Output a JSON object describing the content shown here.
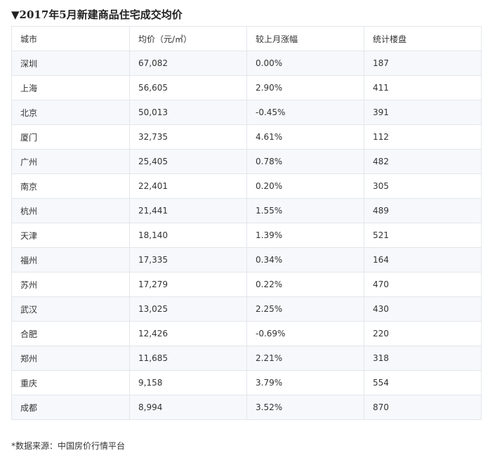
{
  "title": "▼2017年5月新建商品住宅成交均价",
  "table": {
    "headers": [
      "城市",
      "均价（元/㎡）",
      "较上月涨幅",
      "统计楼盘"
    ],
    "rows": [
      [
        "深圳",
        "67,082",
        "0.00%",
        "187"
      ],
      [
        "上海",
        "56,605",
        "2.90%",
        "411"
      ],
      [
        "北京",
        "50,013",
        "-0.45%",
        "391"
      ],
      [
        "厦门",
        "32,735",
        "4.61%",
        "112"
      ],
      [
        "广州",
        "25,405",
        "0.78%",
        "482"
      ],
      [
        "南京",
        "22,401",
        "0.20%",
        "305"
      ],
      [
        "杭州",
        "21,441",
        "1.55%",
        "489"
      ],
      [
        "天津",
        "18,140",
        "1.39%",
        "521"
      ],
      [
        "福州",
        "17,335",
        "0.34%",
        "164"
      ],
      [
        "苏州",
        "17,279",
        "0.22%",
        "470"
      ],
      [
        "武汉",
        "13,025",
        "2.25%",
        "430"
      ],
      [
        "合肥",
        "12,426",
        "-0.69%",
        "220"
      ],
      [
        "郑州",
        "11,685",
        "2.21%",
        "318"
      ],
      [
        "重庆",
        "9,158",
        "3.79%",
        "554"
      ],
      [
        "成都",
        "8,994",
        "3.52%",
        "870"
      ]
    ]
  },
  "source": "*数据来源：中国房价行情平台"
}
